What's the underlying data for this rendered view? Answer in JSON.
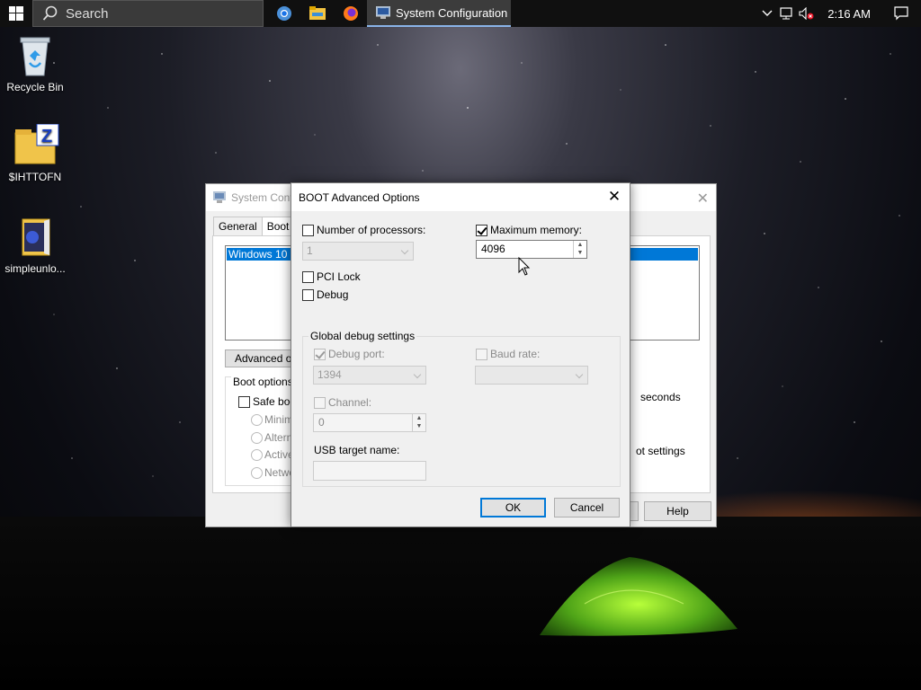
{
  "taskbar": {
    "search_placeholder": "Search",
    "active_app_title": "System Configuration",
    "pinned_apps": [
      "chrome-icon",
      "file-explorer-icon",
      "firefox-icon"
    ],
    "clock": "2:16 AM"
  },
  "desktop": {
    "icons": [
      {
        "label": "Recycle Bin"
      },
      {
        "label": "$IHTTOFN"
      },
      {
        "label": "simpleunlo..."
      }
    ]
  },
  "sysconfig": {
    "title": "System Confi",
    "tabs": [
      "General",
      "Boot"
    ],
    "os_entry": "Windows 10 (C",
    "advanced_button": "Advanced op",
    "boot_options_legend": "Boot options",
    "safe_boot": "Safe boo",
    "radio_options": [
      "Minima",
      "Altern",
      "Active",
      "Netwo"
    ],
    "seconds_label": "seconds",
    "make_permanent": "ot settings",
    "help_button": "Help"
  },
  "dialog": {
    "title": "BOOT Advanced Options",
    "num_processors_label": "Number of processors:",
    "num_processors_checked": false,
    "num_processors_value": "1",
    "max_memory_label": "Maximum memory:",
    "max_memory_checked": true,
    "max_memory_value": "4096",
    "pci_lock_label": "PCI Lock",
    "debug_label": "Debug",
    "global_debug_legend": "Global debug settings",
    "debug_port_label": "Debug port:",
    "debug_port_value": "1394",
    "baud_rate_label": "Baud rate:",
    "baud_rate_value": "",
    "channel_label": "Channel:",
    "channel_value": "0",
    "usb_target_label": "USB target name:",
    "usb_target_value": "",
    "ok_button": "OK",
    "cancel_button": "Cancel"
  },
  "colors": {
    "accent": "#0078d7",
    "taskbar": "#101010",
    "dialog_bg": "#f0f0f0"
  }
}
